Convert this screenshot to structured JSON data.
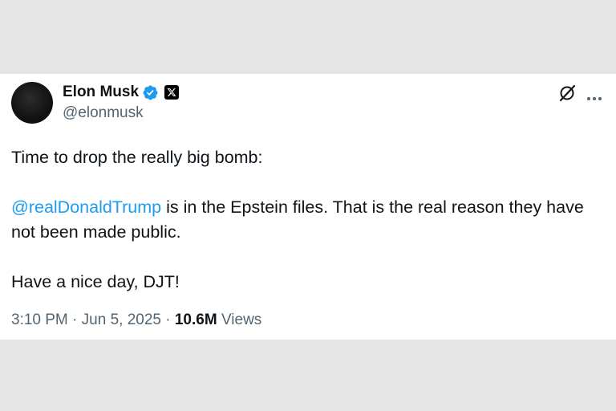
{
  "author": {
    "display_name": "Elon Musk",
    "handle": "@elonmusk",
    "verified_color": "#1d9bf0"
  },
  "icons": {
    "verified": "verified-badge-icon",
    "affiliate": "x-logo-icon",
    "grok": "grok-icon",
    "more": "more-icon"
  },
  "tweet": {
    "line1": "Time to drop the really big bomb:",
    "mention": "@realDonaldTrump",
    "line2_rest": " is in the Epstein files. That is the real reason they have not been made public.",
    "line3": "Have a nice day, DJT!"
  },
  "meta": {
    "time": "3:10 PM",
    "separator": " · ",
    "date": "Jun 5, 2025",
    "views_count": "10.6M",
    "views_label": " Views"
  },
  "colors": {
    "link": "#1d9bf0",
    "secondary_text": "#536471",
    "primary_text": "#0f1419",
    "background": "#e5e5e5"
  }
}
